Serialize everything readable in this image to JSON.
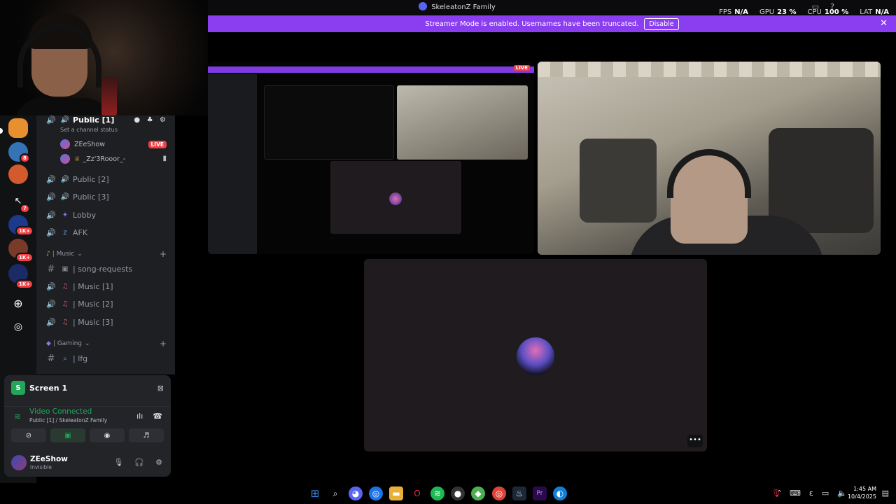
{
  "window": {
    "title": "SkeleatonZ Family",
    "perf": [
      {
        "label": "FPS",
        "value": "N/A"
      },
      {
        "label": "GPU",
        "value": "23 %"
      },
      {
        "label": "CPU",
        "value": "100 %"
      },
      {
        "label": "LAT",
        "value": "N/A"
      }
    ]
  },
  "banner": {
    "text": "Streamer Mode is enabled. Usernames have been truncated.",
    "button": "Disable"
  },
  "servers": [
    {
      "icon": "server-orange",
      "badge": ""
    },
    {
      "icon": "server-blue",
      "badge": "8"
    },
    {
      "icon": "server-cloud",
      "badge": ""
    },
    {
      "icon": "server-cursor",
      "badge": "7"
    },
    {
      "icon": "server-circle",
      "badge": "1K+"
    },
    {
      "icon": "server-anime",
      "badge": "1K+"
    },
    {
      "icon": "server-dark",
      "badge": "1K+"
    }
  ],
  "channels": {
    "public1": {
      "label": "Public [1]",
      "status": "Set a channel status"
    },
    "users": [
      {
        "name": "ZEeShow",
        "live": "LIVE"
      },
      {
        "name": "_Zz'3Rooor_-",
        "live": ""
      }
    ],
    "voice_channels": [
      {
        "label": "Public [2]"
      },
      {
        "label": "Public [3]"
      },
      {
        "label": "Lobby"
      },
      {
        "label": "AFK"
      }
    ],
    "music_category": "| Music",
    "music_channels": [
      {
        "label": "| song-requests"
      },
      {
        "label": "| Music [1]"
      },
      {
        "label": "| Music [2]"
      },
      {
        "label": "| Music [3]"
      }
    ],
    "gaming_category": "| Gaming",
    "gaming_channels": [
      {
        "label": "| lfg"
      }
    ]
  },
  "voice_panel": {
    "title": "Screen 1",
    "status": "Video Connected",
    "sub": "Public [1] / SkeleatonZ Family"
  },
  "account": {
    "name": "ZEeShow",
    "status": "Invisible"
  },
  "taskbar": {
    "time": "1:45 AM",
    "date": "10/4/2025"
  },
  "colors": {
    "accent": "#8a3ef0",
    "live": "#f23f43",
    "connected": "#23a55a"
  }
}
